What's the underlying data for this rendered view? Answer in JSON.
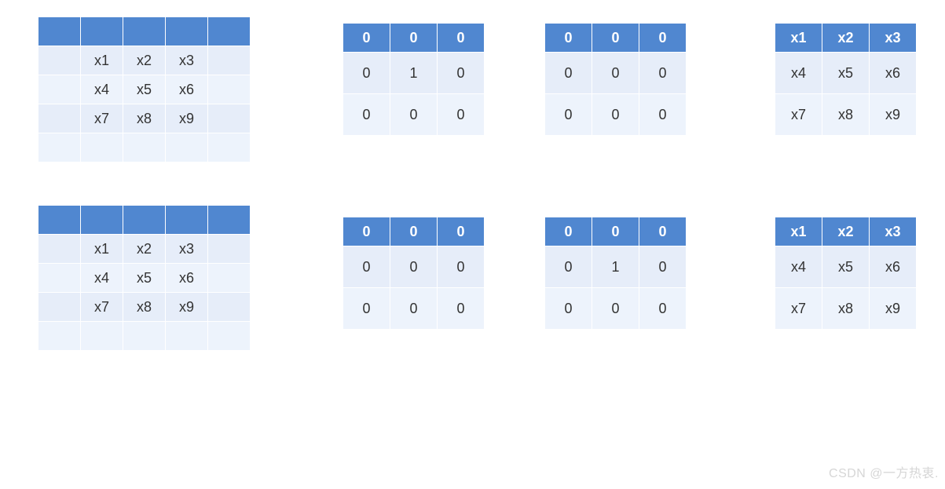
{
  "row1": {
    "input": {
      "header": [
        "",
        "",
        "",
        "",
        ""
      ],
      "rows": [
        [
          "",
          "x1",
          "x2",
          "x3",
          ""
        ],
        [
          "",
          "x4",
          "x5",
          "x6",
          ""
        ],
        [
          "",
          "x7",
          "x8",
          "x9",
          ""
        ],
        [
          "",
          "",
          "",
          "",
          ""
        ]
      ]
    },
    "kernel1": {
      "header": [
        "0",
        "0",
        "0"
      ],
      "rows": [
        [
          "0",
          "1",
          "0"
        ],
        [
          "0",
          "0",
          "0"
        ]
      ]
    },
    "kernel2": {
      "header": [
        "0",
        "0",
        "0"
      ],
      "rows": [
        [
          "0",
          "0",
          "0"
        ],
        [
          "0",
          "0",
          "0"
        ]
      ]
    },
    "output": {
      "header": [
        "x1",
        "x2",
        "x3"
      ],
      "rows": [
        [
          "x4",
          "x5",
          "x6"
        ],
        [
          "x7",
          "x8",
          "x9"
        ]
      ]
    }
  },
  "row2": {
    "input": {
      "header": [
        "",
        "",
        "",
        "",
        ""
      ],
      "rows": [
        [
          "",
          "x1",
          "x2",
          "x3",
          ""
        ],
        [
          "",
          "x4",
          "x5",
          "x6",
          ""
        ],
        [
          "",
          "x7",
          "x8",
          "x9",
          ""
        ],
        [
          "",
          "",
          "",
          "",
          ""
        ]
      ]
    },
    "kernel1": {
      "header": [
        "0",
        "0",
        "0"
      ],
      "rows": [
        [
          "0",
          "0",
          "0"
        ],
        [
          "0",
          "0",
          "0"
        ]
      ]
    },
    "kernel2": {
      "header": [
        "0",
        "0",
        "0"
      ],
      "rows": [
        [
          "0",
          "1",
          "0"
        ],
        [
          "0",
          "0",
          "0"
        ]
      ]
    },
    "output": {
      "header": [
        "x1",
        "x2",
        "x3"
      ],
      "rows": [
        [
          "x4",
          "x5",
          "x6"
        ],
        [
          "x7",
          "x8",
          "x9"
        ]
      ]
    }
  },
  "watermark": "CSDN @一方热衷."
}
